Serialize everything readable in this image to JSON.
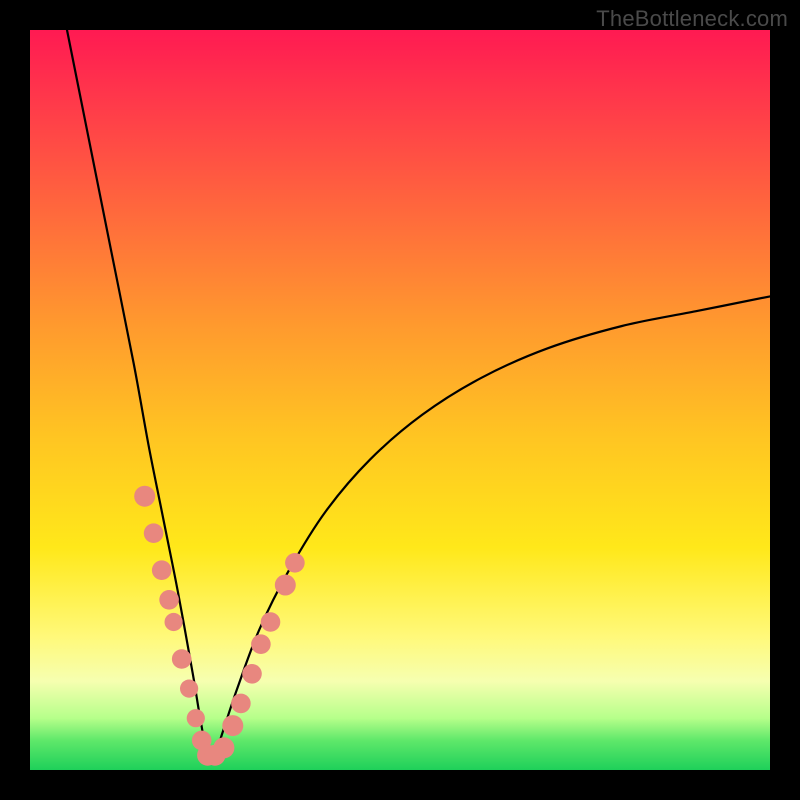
{
  "watermark": "TheBottleneck.com",
  "colors": {
    "frame": "#000000",
    "curve": "#000000",
    "point_fill": "#e8877f",
    "point_stroke": "#dd7a74",
    "gradient": [
      "#ff1a52",
      "#ff9a2e",
      "#ffe81a",
      "#1ed05a"
    ]
  },
  "chart_data": {
    "type": "line",
    "title": "",
    "xlabel": "",
    "ylabel": "",
    "xlim": [
      0,
      100
    ],
    "ylim": [
      0,
      100
    ],
    "grid": false,
    "description": "V-shaped bottleneck curve; y value is the absolute mismatch percentage, minimized near x≈24 where it touches the green band (~2%), rising steeply to ~100% at x=0 and asymptotically toward ~64% at x=100. Salmon dots mark sampled hardware points clustered near the minimum on both branches.",
    "series": [
      {
        "name": "bottleneck-curve",
        "x": [
          5,
          8,
          11,
          14,
          16,
          18,
          20,
          22,
          23,
          24,
          25,
          26,
          28,
          31,
          35,
          40,
          46,
          53,
          61,
          70,
          80,
          90,
          100
        ],
        "y": [
          100,
          85,
          70,
          55,
          44,
          34,
          24,
          13,
          7,
          2,
          2,
          5,
          11,
          19,
          27,
          35,
          42,
          48,
          53,
          57,
          60,
          62,
          64
        ]
      }
    ],
    "points": [
      {
        "x": 15.5,
        "y": 37,
        "r": 1.5
      },
      {
        "x": 16.7,
        "y": 32,
        "r": 1.4
      },
      {
        "x": 17.8,
        "y": 27,
        "r": 1.4
      },
      {
        "x": 18.8,
        "y": 23,
        "r": 1.4
      },
      {
        "x": 19.4,
        "y": 20,
        "r": 1.3
      },
      {
        "x": 20.5,
        "y": 15,
        "r": 1.4
      },
      {
        "x": 21.5,
        "y": 11,
        "r": 1.3
      },
      {
        "x": 22.4,
        "y": 7,
        "r": 1.3
      },
      {
        "x": 23.2,
        "y": 4,
        "r": 1.4
      },
      {
        "x": 24.0,
        "y": 2,
        "r": 1.5
      },
      {
        "x": 25.0,
        "y": 2,
        "r": 1.5
      },
      {
        "x": 26.2,
        "y": 3,
        "r": 1.5
      },
      {
        "x": 27.4,
        "y": 6,
        "r": 1.5
      },
      {
        "x": 28.5,
        "y": 9,
        "r": 1.4
      },
      {
        "x": 30.0,
        "y": 13,
        "r": 1.4
      },
      {
        "x": 31.2,
        "y": 17,
        "r": 1.4
      },
      {
        "x": 32.5,
        "y": 20,
        "r": 1.4
      },
      {
        "x": 34.5,
        "y": 25,
        "r": 1.5
      },
      {
        "x": 35.8,
        "y": 28,
        "r": 1.4
      }
    ]
  }
}
